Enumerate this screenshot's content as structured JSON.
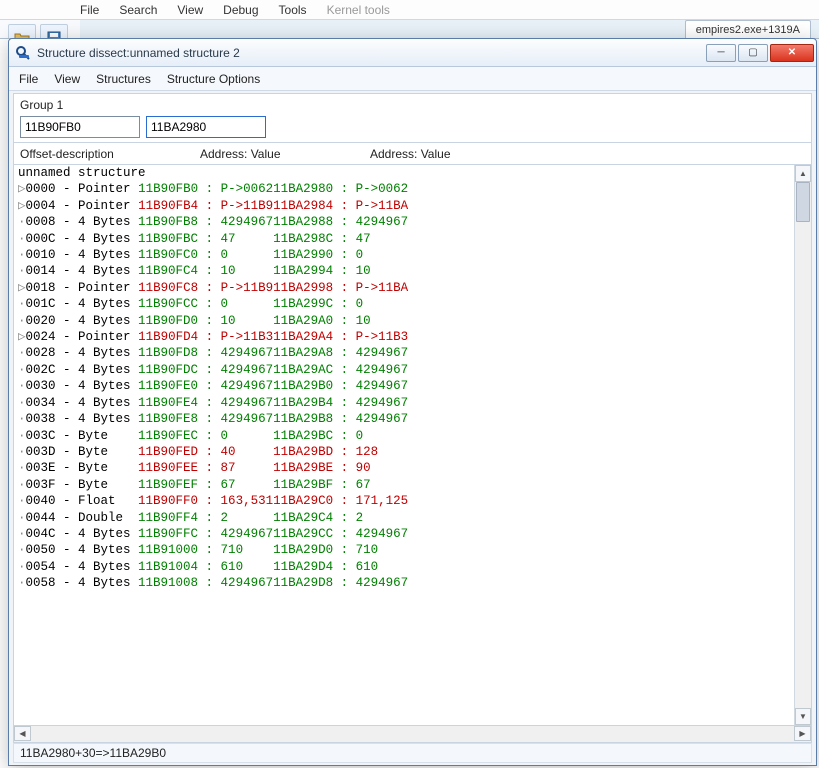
{
  "bg": {
    "menu": [
      "File",
      "Search",
      "View",
      "Debug",
      "Tools",
      "Kernel tools"
    ],
    "tab": "empires2.exe+1319A"
  },
  "window": {
    "title": "Structure dissect:unnamed structure 2",
    "menus": [
      "File",
      "View",
      "Structures",
      "Structure Options"
    ],
    "group_label": "Group 1",
    "addr1": "11B90FB0",
    "addr2": "11BA2980",
    "addr2_caret": "|",
    "headers": {
      "c1": "Offset-description",
      "c2": "Address: Value",
      "c3": "Address: Value"
    },
    "struct_name": "unnamed structure",
    "status": "11BA2980+30=>11BA29B0"
  },
  "rows": [
    {
      "glyph": "▷",
      "offset": "0000",
      "type": "Pointer",
      "a1": "11B90FB0",
      "v1": "P->0062",
      "a2": "11BA2980",
      "v2": "P->0062",
      "color": "green"
    },
    {
      "glyph": "▷",
      "offset": "0004",
      "type": "Pointer",
      "a1": "11B90FB4",
      "v1": "P->11B9",
      "a2": "11BA2984",
      "v2": "P->11BA",
      "color": "red"
    },
    {
      "glyph": "·",
      "offset": "0008",
      "type": "4 Bytes",
      "a1": "11B90FB8",
      "v1": "4294967",
      "a2": "11BA2988",
      "v2": "4294967",
      "color": "green"
    },
    {
      "glyph": "·",
      "offset": "000C",
      "type": "4 Bytes",
      "a1": "11B90FBC",
      "v1": "47",
      "a2": "11BA298C",
      "v2": "47",
      "color": "green"
    },
    {
      "glyph": "·",
      "offset": "0010",
      "type": "4 Bytes",
      "a1": "11B90FC0",
      "v1": "0",
      "a2": "11BA2990",
      "v2": "0",
      "color": "green"
    },
    {
      "glyph": "·",
      "offset": "0014",
      "type": "4 Bytes",
      "a1": "11B90FC4",
      "v1": "10",
      "a2": "11BA2994",
      "v2": "10",
      "color": "green"
    },
    {
      "glyph": "▷",
      "offset": "0018",
      "type": "Pointer",
      "a1": "11B90FC8",
      "v1": "P->11B9",
      "a2": "11BA2998",
      "v2": "P->11BA",
      "color": "red"
    },
    {
      "glyph": "·",
      "offset": "001C",
      "type": "4 Bytes",
      "a1": "11B90FCC",
      "v1": "0",
      "a2": "11BA299C",
      "v2": "0",
      "color": "green"
    },
    {
      "glyph": "·",
      "offset": "0020",
      "type": "4 Bytes",
      "a1": "11B90FD0",
      "v1": "10",
      "a2": "11BA29A0",
      "v2": "10",
      "color": "green"
    },
    {
      "glyph": "▷",
      "offset": "0024",
      "type": "Pointer",
      "a1": "11B90FD4",
      "v1": "P->11B3",
      "a2": "11BA29A4",
      "v2": "P->11B3",
      "color": "red"
    },
    {
      "glyph": "·",
      "offset": "0028",
      "type": "4 Bytes",
      "a1": "11B90FD8",
      "v1": "4294967",
      "a2": "11BA29A8",
      "v2": "4294967",
      "color": "green"
    },
    {
      "glyph": "·",
      "offset": "002C",
      "type": "4 Bytes",
      "a1": "11B90FDC",
      "v1": "4294967",
      "a2": "11BA29AC",
      "v2": "4294967",
      "color": "green"
    },
    {
      "glyph": "·",
      "offset": "0030",
      "type": "4 Bytes",
      "a1": "11B90FE0",
      "v1": "4294967",
      "a2": "11BA29B0",
      "v2": "4294967",
      "color": "green"
    },
    {
      "glyph": "·",
      "offset": "0034",
      "type": "4 Bytes",
      "a1": "11B90FE4",
      "v1": "4294967",
      "a2": "11BA29B4",
      "v2": "4294967",
      "color": "green"
    },
    {
      "glyph": "·",
      "offset": "0038",
      "type": "4 Bytes",
      "a1": "11B90FE8",
      "v1": "4294967",
      "a2": "11BA29B8",
      "v2": "4294967",
      "color": "green"
    },
    {
      "glyph": "·",
      "offset": "003C",
      "type": "Byte",
      "a1": "11B90FEC",
      "v1": "0",
      "a2": "11BA29BC",
      "v2": "0",
      "color": "green"
    },
    {
      "glyph": "·",
      "offset": "003D",
      "type": "Byte",
      "a1": "11B90FED",
      "v1": "40",
      "a2": "11BA29BD",
      "v2": "128",
      "color": "red"
    },
    {
      "glyph": "·",
      "offset": "003E",
      "type": "Byte",
      "a1": "11B90FEE",
      "v1": "87",
      "a2": "11BA29BE",
      "v2": "90",
      "color": "red"
    },
    {
      "glyph": "·",
      "offset": "003F",
      "type": "Byte",
      "a1": "11B90FEF",
      "v1": "67",
      "a2": "11BA29BF",
      "v2": "67",
      "color": "green"
    },
    {
      "glyph": "·",
      "offset": "0040",
      "type": "Float",
      "a1": "11B90FF0",
      "v1": "163,531",
      "a2": "11BA29C0",
      "v2": "171,125",
      "color": "red"
    },
    {
      "glyph": "·",
      "offset": "0044",
      "type": "Double",
      "a1": "11B90FF4",
      "v1": "2",
      "a2": "11BA29C4",
      "v2": "2",
      "color": "green"
    },
    {
      "glyph": "·",
      "offset": "004C",
      "type": "4 Bytes",
      "a1": "11B90FFC",
      "v1": "4294967",
      "a2": "11BA29CC",
      "v2": "4294967",
      "color": "green"
    },
    {
      "glyph": "·",
      "offset": "0050",
      "type": "4 Bytes",
      "a1": "11B91000",
      "v1": "710",
      "a2": "11BA29D0",
      "v2": "710",
      "color": "green"
    },
    {
      "glyph": "·",
      "offset": "0054",
      "type": "4 Bytes",
      "a1": "11B91004",
      "v1": "610",
      "a2": "11BA29D4",
      "v2": "610",
      "color": "green"
    },
    {
      "glyph": "·",
      "offset": "0058",
      "type": "4 Bytes",
      "a1": "11B91008",
      "v1": "4294967",
      "a2": "11BA29D8",
      "v2": "4294967",
      "color": "green"
    }
  ]
}
